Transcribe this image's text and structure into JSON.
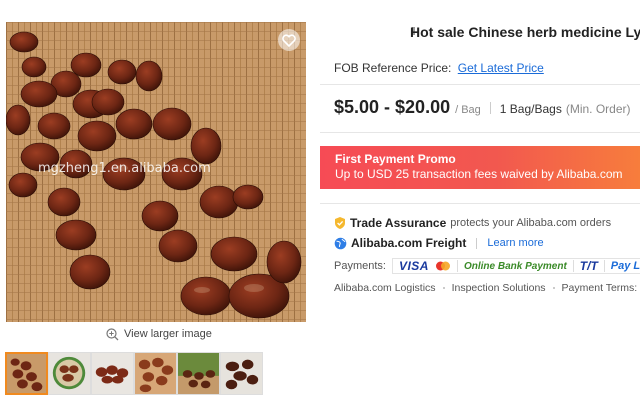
{
  "product": {
    "title": "Hot sale Chinese herb medicine Lych",
    "main_image_alt": "",
    "view_larger_label": "View larger image",
    "watermark": "mgzheng1.en.alibaba.com",
    "thumbnails": [
      "thumb-1",
      "thumb-2",
      "thumb-3",
      "thumb-4",
      "thumb-5",
      "thumb-6"
    ],
    "active_thumbnail_index": 0
  },
  "pricing": {
    "fob_label": "FOB Reference",
    "fob_price_label": "Price:",
    "fob_link": "Get Latest Price",
    "price_range": "$5.00 - $20.00",
    "unit": "/ Bag",
    "moq": "1 Bag/Bags",
    "moq_note": "(Min. Order)"
  },
  "promo": {
    "title": "First Payment Promo",
    "text": "Up to USD 25 transaction fees waived by Alibaba.com",
    "colors": {
      "start": "#f64b55",
      "end": "#f77d3c"
    }
  },
  "services": {
    "trade_assurance_label": "Trade Assurance",
    "trade_assurance_text": "protects your Alibaba.com orders",
    "freight_label": "Alibaba.com Freight",
    "freight_link": "Learn more",
    "payments_label": "Payments:",
    "payment_methods": [
      "VISA",
      "Online Bank Payment",
      "T/T",
      "Pay Later"
    ],
    "links": [
      "Alibaba.com Logistics",
      "Inspection Solutions",
      "Payment Terms: Ne"
    ]
  },
  "colors": {
    "link": "#1a6bd8",
    "accent": "#f08a1f",
    "promo": "#f64b55"
  },
  "icons": {
    "favorite": "heart-icon",
    "zoom": "zoom-in-icon",
    "trade_assurance": "shield-icon",
    "freight": "globe-icon",
    "mastercard": "mastercard-icon"
  }
}
